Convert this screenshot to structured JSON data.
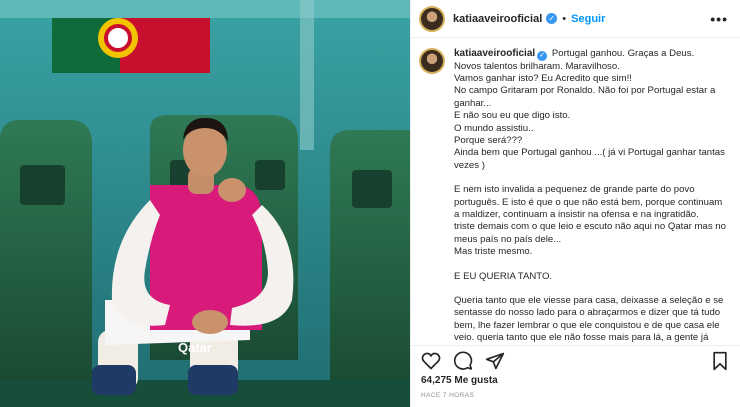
{
  "post": {
    "username": "katiaaveirooficial",
    "verified_mark": "✓",
    "separator": "•",
    "follow_label": "Seguir",
    "more_icon": "more-dots-icon",
    "caption_first": "Portugal ganhou. Graças a Deus.",
    "caption_lines": [
      "Novos talentos brilharam. Maravilhoso.",
      "Vamos ganhar isto? Eu Acredito que sim!!",
      "No campo Gritaram por Ronaldo. Não foi por Portugal estar a ganhar...",
      "E não sou eu que digo isto.",
      "O mundo assistiu..",
      "Porque será???",
      "Ainda bem que Portugal ganhou ...( já vi Portugal ganhar tantas vezes )",
      "",
      "E nem isto invalida a pequenez de grande parte do povo português. E isto é que o que não está bem, porque continuam a maldizer, continuam a insistir na ofensa e na ingratidão.",
      "triste demais com o que leio e escuto não aqui no Qatar mas no meus país no país dele...",
      "Mas triste mesmo.",
      "",
      "E EU QUERIA TANTO.",
      "",
      "Queria tanto que ele viesse para casa, deixasse a seleção e se sentasse do nosso lado para o abraçarmos e dizer que tá tudo bem, lhe fazer lembrar o que ele conquistou e de que casa ele veio. queria tanto que ele não fosse mais para lá, a gente já"
    ],
    "likes": "64,275 Me gusta",
    "time": "HACE 7 HORAS"
  },
  "icons": [
    "heart-icon",
    "comment-icon",
    "share-icon",
    "bookmark-icon"
  ],
  "photo": {
    "alt": "Jogador sentado no banco de suplentes",
    "shirt_text": "Qatar"
  }
}
